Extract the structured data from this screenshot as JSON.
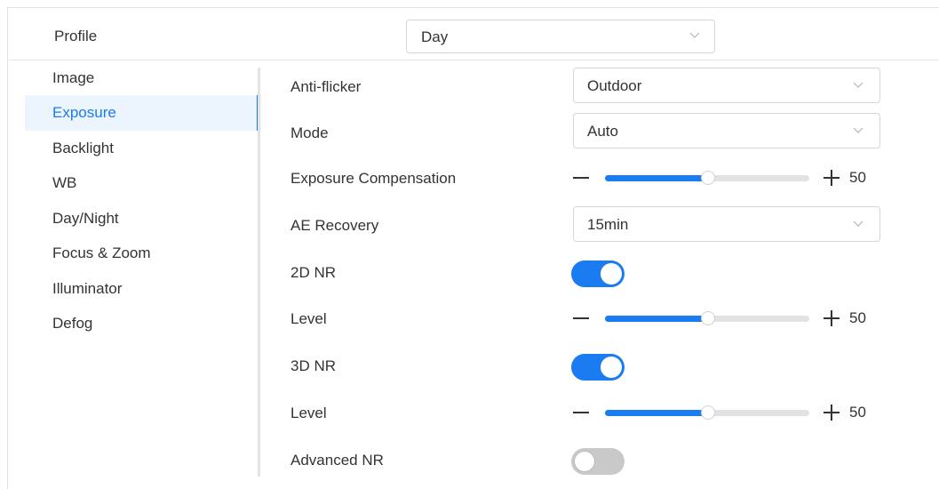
{
  "profile": {
    "label": "Profile",
    "value": "Day"
  },
  "nav": {
    "items": [
      {
        "label": "Image"
      },
      {
        "label": "Exposure",
        "active": true
      },
      {
        "label": "Backlight"
      },
      {
        "label": "WB"
      },
      {
        "label": "Day/Night"
      },
      {
        "label": "Focus & Zoom"
      },
      {
        "label": "Illuminator"
      },
      {
        "label": "Defog"
      }
    ]
  },
  "settings": {
    "anti_flicker": {
      "label": "Anti-flicker",
      "value": "Outdoor"
    },
    "mode": {
      "label": "Mode",
      "value": "Auto"
    },
    "exposure_compensation": {
      "label": "Exposure Compensation",
      "value": "50"
    },
    "ae_recovery": {
      "label": "AE Recovery",
      "value": "15min"
    },
    "nr_2d": {
      "label": "2D NR",
      "enabled": true
    },
    "nr_2d_level": {
      "label": "Level",
      "value": "50"
    },
    "nr_3d": {
      "label": "3D NR",
      "enabled": true
    },
    "nr_3d_level": {
      "label": "Level",
      "value": "50"
    },
    "advanced_nr": {
      "label": "Advanced NR",
      "enabled": false
    }
  },
  "colors": {
    "accent": "#1a7cf0",
    "nav_active_bg": "#ecf4fe",
    "track": "#e2e2e2",
    "toggle_off": "#c9c9c9"
  }
}
